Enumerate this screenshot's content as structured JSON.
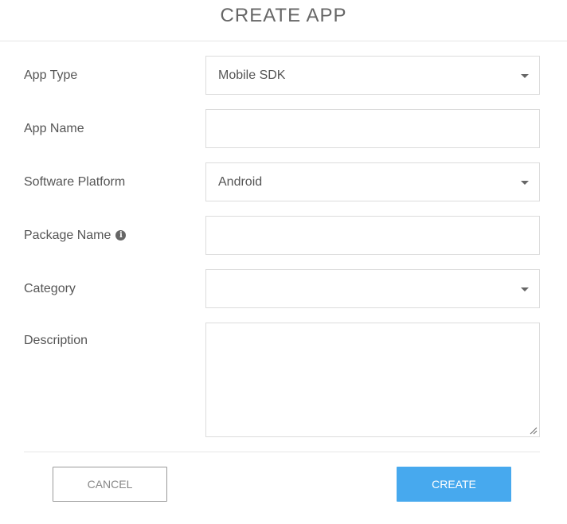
{
  "dialog": {
    "title": "CREATE APP"
  },
  "form": {
    "app_type": {
      "label": "App Type",
      "value": "Mobile SDK"
    },
    "app_name": {
      "label": "App Name",
      "value": ""
    },
    "software_platform": {
      "label": "Software Platform",
      "value": "Android"
    },
    "package_name": {
      "label": "Package Name",
      "value": "",
      "icon": "info-icon"
    },
    "category": {
      "label": "Category",
      "value": ""
    },
    "description": {
      "label": "Description",
      "value": ""
    }
  },
  "footer": {
    "cancel_label": "CANCEL",
    "create_label": "CREATE"
  },
  "colors": {
    "primary": "#47a9ee",
    "text": "#555555",
    "border": "#dcdcdc"
  }
}
